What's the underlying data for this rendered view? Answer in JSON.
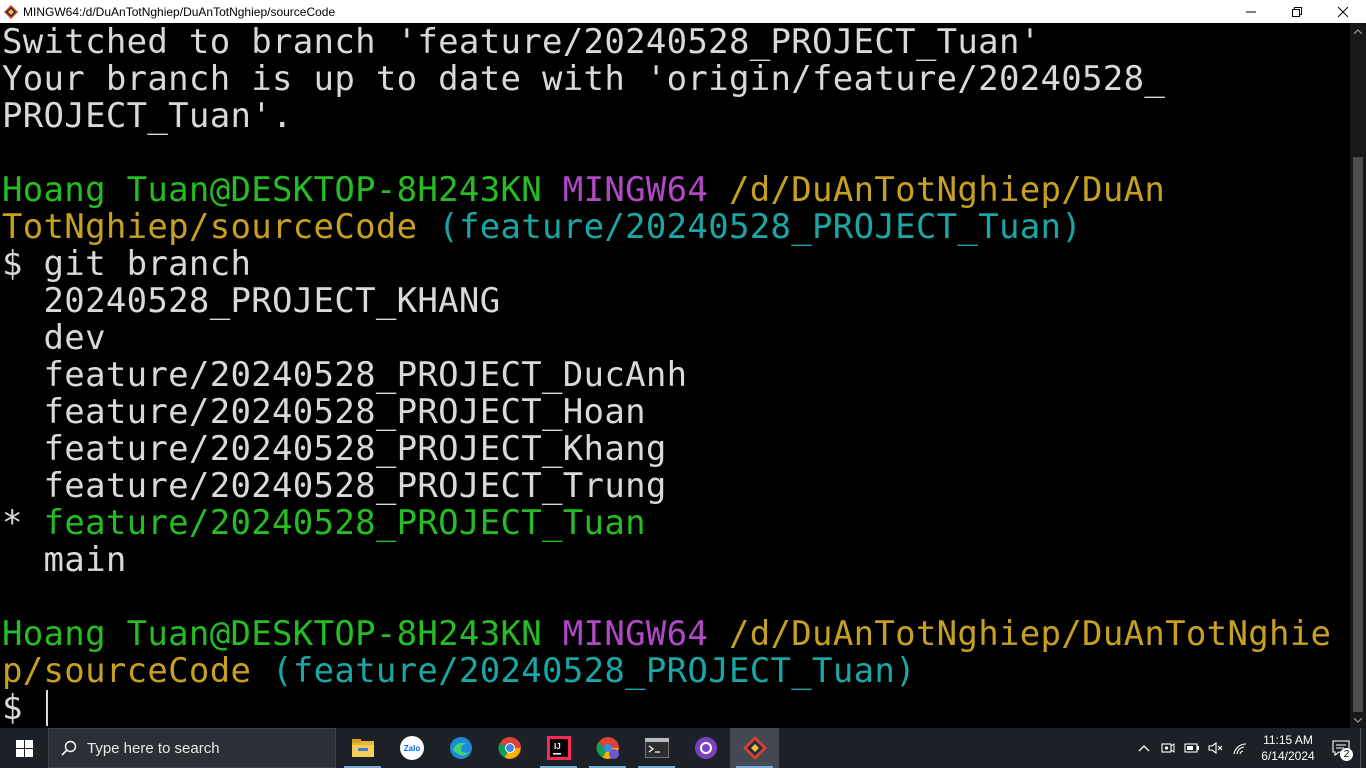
{
  "window": {
    "title": "MINGW64:/d/DuAnTotNghiep/DuAnTotNghiep/sourceCode"
  },
  "terminal": {
    "colors": {
      "green": "#25bc24",
      "magenta": "#b148c6",
      "yellow": "#c7a020",
      "cyan": "#1ba6a6",
      "text": "#d9d9d9",
      "background": "#000000"
    },
    "output": {
      "switched_line": "Switched to branch 'feature/20240528_PROJECT_Tuan'",
      "up_to_date_line1": "Your branch is up to date with 'origin/feature/20240528_",
      "up_to_date_line2": "PROJECT_Tuan'."
    },
    "prompt1": {
      "user_host": "Hoang Tuan@DESKTOP-8H243KN",
      "shell": "MINGW64",
      "path_part1": "/d/DuAnTotNghiep/DuAn",
      "path_part2": "TotNghiep/sourceCode",
      "branch": "(feature/20240528_PROJECT_Tuan)"
    },
    "command": "$ git branch",
    "branches": [
      "  20240528_PROJECT_KHANG",
      "  dev",
      "  feature/20240528_PROJECT_DucAnh",
      "  feature/20240528_PROJECT_Hoan",
      "  feature/20240528_PROJECT_Khang",
      "  feature/20240528_PROJECT_Trung"
    ],
    "current_branch": {
      "marker": "* ",
      "name": "feature/20240528_PROJECT_Tuan"
    },
    "last_branch": "  main",
    "prompt2": {
      "user_host": "Hoang Tuan@DESKTOP-8H243KN",
      "shell": "MINGW64",
      "path_part1": "/d/DuAnTotNghiep/DuAnTotNghie",
      "path_part2": "p/sourceCode",
      "branch": "(feature/20240528_PROJECT_Tuan)"
    },
    "input_prompt": "$ "
  },
  "taskbar": {
    "search_placeholder": "Type here to search",
    "apps": [
      {
        "name": "file-explorer-icon"
      },
      {
        "name": "zalo-icon",
        "label": "Zalo"
      },
      {
        "name": "edge-icon"
      },
      {
        "name": "chrome-icon"
      },
      {
        "name": "intellij-icon",
        "label": "IJ"
      },
      {
        "name": "chrome-profile-icon"
      },
      {
        "name": "terminal-icon"
      },
      {
        "name": "github-desktop-icon"
      },
      {
        "name": "git-bash-icon"
      }
    ],
    "clock": {
      "time": "11:15 AM",
      "date": "6/14/2024"
    },
    "notification_count": "2"
  }
}
